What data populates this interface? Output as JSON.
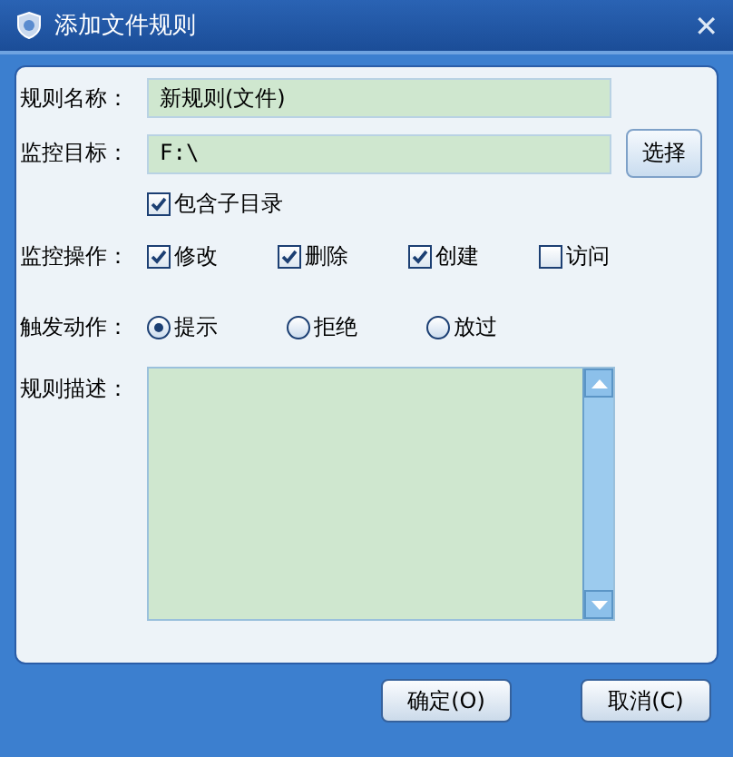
{
  "window": {
    "title": "添加文件规则",
    "close": "✕"
  },
  "name": {
    "label": "规则名称：",
    "value": "新规则(文件)"
  },
  "target": {
    "label": "监控目标：",
    "value": "F:\\",
    "button": "选择"
  },
  "include_sub": {
    "label": "包含子目录",
    "checked": true
  },
  "operations": {
    "label": "监控操作：",
    "items": [
      {
        "label": "修改",
        "checked": true
      },
      {
        "label": "删除",
        "checked": true
      },
      {
        "label": "创建",
        "checked": true
      },
      {
        "label": "访问",
        "checked": false
      }
    ]
  },
  "trigger": {
    "label": "触发动作：",
    "items": [
      {
        "label": "提示",
        "selected": true
      },
      {
        "label": "拒绝",
        "selected": false
      },
      {
        "label": "放过",
        "selected": false
      }
    ]
  },
  "description": {
    "label": "规则描述："
  },
  "buttons": [
    "确定(O)",
    "取消(C)"
  ]
}
